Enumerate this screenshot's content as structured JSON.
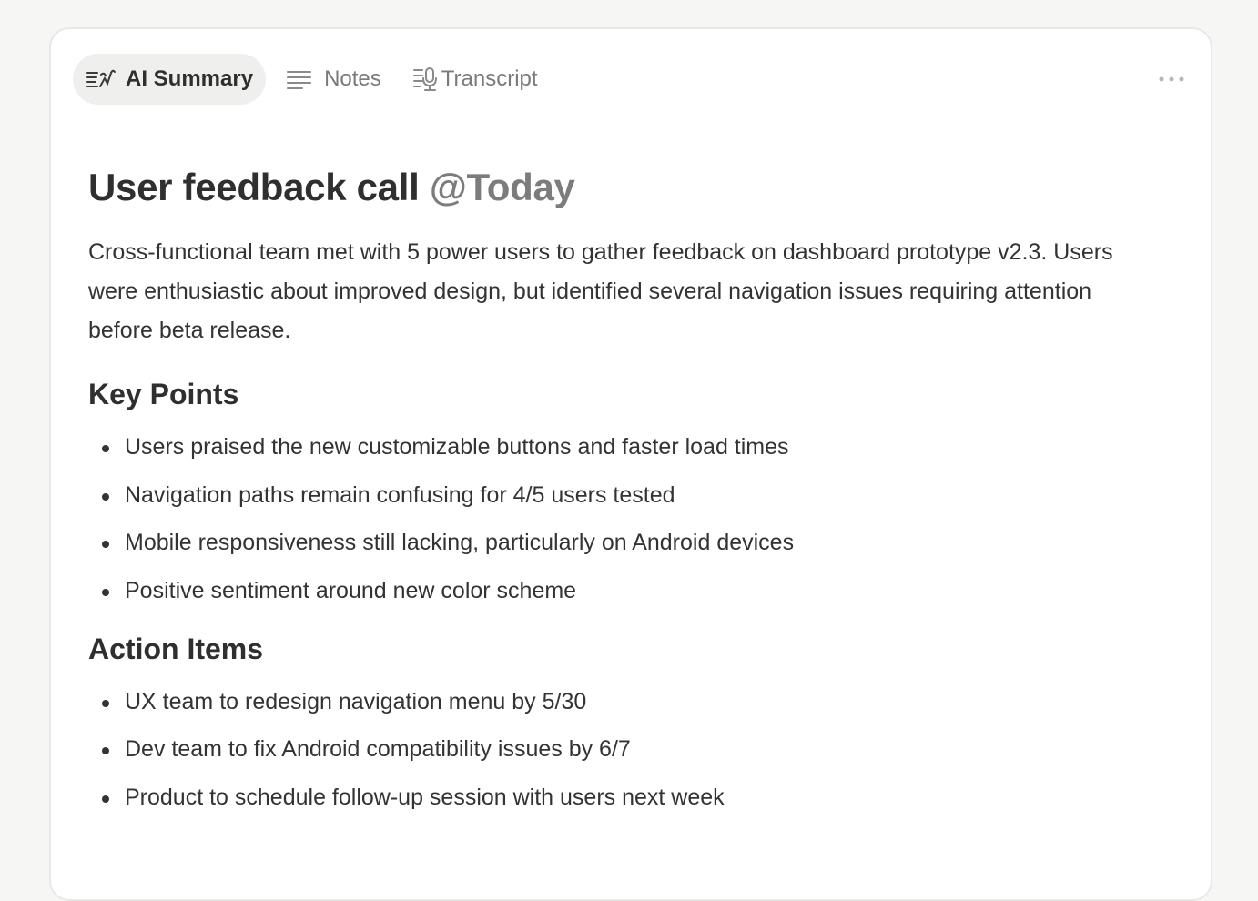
{
  "tabs": [
    {
      "label": "AI Summary",
      "icon": "ai-summary-icon",
      "active": true
    },
    {
      "label": "Notes",
      "icon": "notes-icon",
      "active": false
    },
    {
      "label": "Transcript",
      "icon": "transcript-icon",
      "active": false
    }
  ],
  "menu": {
    "icon": "more-options-icon"
  },
  "document": {
    "title": "User feedback call",
    "mention": "@Today",
    "summary": "Cross-functional team met with 5 power users to gather feedback on dashboard prototype v2.3. Users were enthusiastic about improved design, but identified several navigation issues requiring attention before beta release.",
    "sections": [
      {
        "heading": "Key Points",
        "items": [
          "Users praised the new customizable buttons and faster load times",
          "Navigation paths remain confusing for 4/5 users tested",
          "Mobile responsiveness still lacking, particularly on Android devices",
          "Positive sentiment around new color scheme"
        ]
      },
      {
        "heading": "Action Items",
        "items": [
          "UX team to redesign navigation menu by 5/30",
          "Dev team to fix Android compatibility issues by 6/7",
          "Product to schedule follow-up session with users next week"
        ]
      }
    ]
  },
  "colors": {
    "background": "#f6f6f5",
    "card": "#ffffff",
    "active_tab": "#efefee",
    "muted_text": "#7a7a78",
    "body_text": "#333333"
  }
}
